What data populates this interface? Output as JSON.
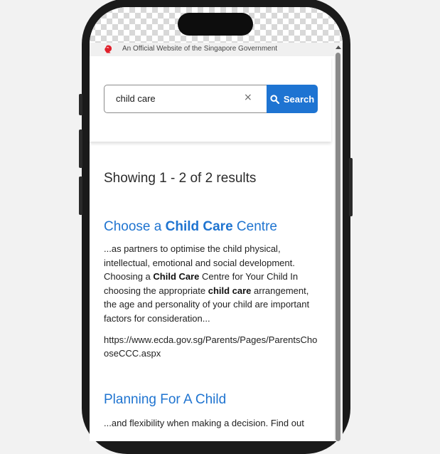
{
  "masthead": {
    "text": "An Official Website of the Singapore Government"
  },
  "search": {
    "value": "child care",
    "clear_symbol": "×",
    "button_label": "Search"
  },
  "results_summary": "Showing 1 - 2 of 2 results",
  "results": [
    {
      "title_prefix": "Choose a ",
      "title_bold": "Child Care",
      "title_suffix": " Centre",
      "snippet_parts": [
        "...as partners to optimise the child physical, intellectual, emotional and social development. Choosing a ",
        "Child Care",
        " Centre for Your Child In choosing the appropriate ",
        "child care",
        " arrangement, the age and personality of your child are important factors for consideration..."
      ],
      "url": "https://www.ecda.gov.sg/Parents/Pages/ParentsChooseCCC.aspx"
    },
    {
      "title": "Planning For A Child",
      "snippet": "...and flexibility when making a decision. Find out"
    }
  ],
  "colors": {
    "accent": "#1e74d2",
    "link": "#1f74d0",
    "lion": "#e0202b"
  },
  "icons": {
    "masthead": "singapore-lion-icon",
    "search": "magnifier-icon",
    "clear": "close-icon"
  }
}
